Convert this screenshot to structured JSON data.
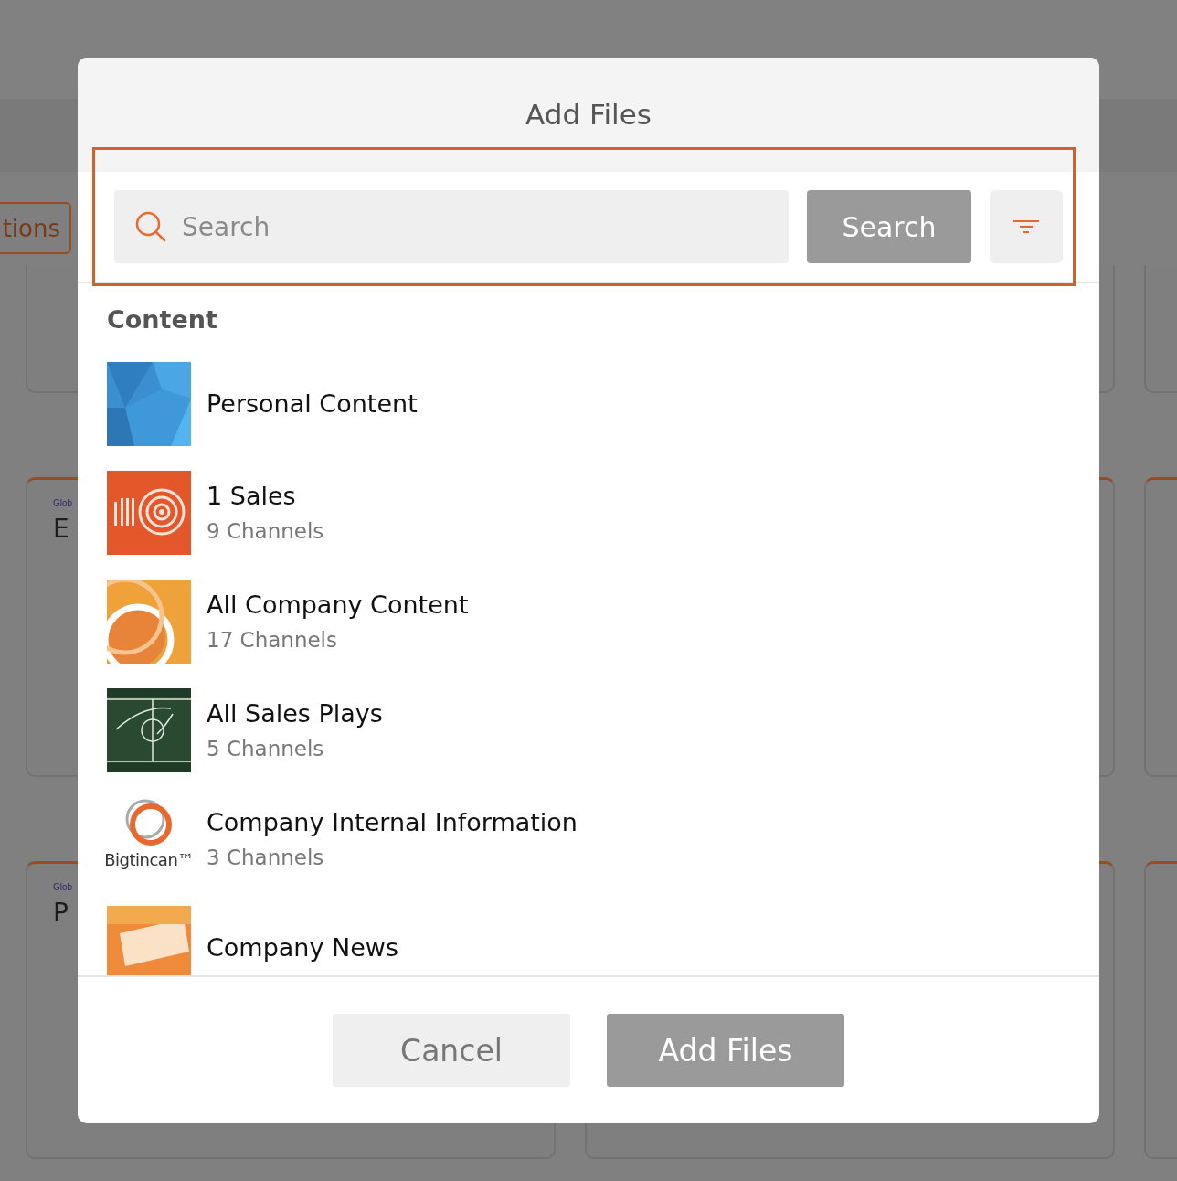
{
  "background": {
    "toolbar_button": "tions",
    "cards": [
      {
        "accent": false
      },
      {
        "accent": false
      },
      {
        "accent": false
      },
      {
        "accent": true,
        "label": "Glob",
        "title": "E"
      },
      {
        "accent": true
      },
      {
        "accent": true
      },
      {
        "accent": true,
        "label": "Glob",
        "title": "P"
      },
      {
        "accent": true
      },
      {
        "accent": true
      }
    ]
  },
  "dialog": {
    "title": "Add Files",
    "search": {
      "placeholder": "Search",
      "button": "Search"
    },
    "section": "Content",
    "items": [
      {
        "kind": "blue",
        "title": "Personal Content"
      },
      {
        "kind": "target",
        "title": "1 Sales",
        "subtitle": "9 Channels"
      },
      {
        "kind": "rings",
        "title": "All Company Content",
        "subtitle": "17 Channels"
      },
      {
        "kind": "field",
        "title": "All Sales Plays",
        "subtitle": "5 Channels"
      },
      {
        "kind": "logo",
        "logo_text": "Bigtincan™",
        "title": "Company Internal Information",
        "subtitle": "3 Channels"
      },
      {
        "kind": "news",
        "title": "Company News"
      }
    ],
    "buttons": [
      {
        "label": "Cancel",
        "kind": "secondary"
      },
      {
        "label": "Add Files",
        "kind": "primary"
      }
    ]
  }
}
